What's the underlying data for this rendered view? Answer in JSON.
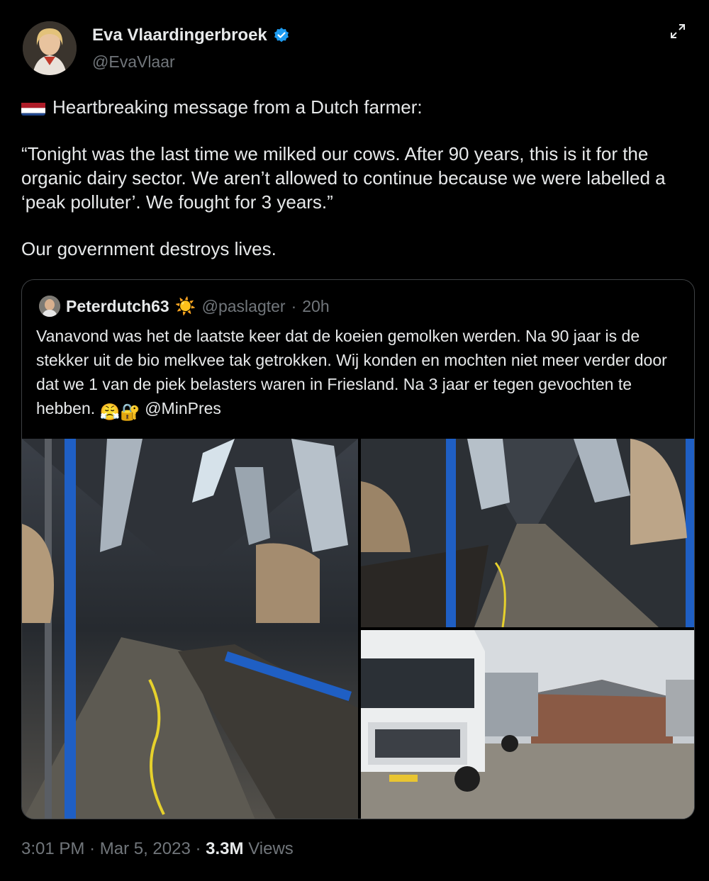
{
  "author": {
    "name": "Eva Vlaardingerbroek",
    "handle": "@EvaVlaar",
    "verified": true
  },
  "tweet": {
    "flag_icon": "netherlands-flag-icon",
    "line1": "Heartbreaking message from a Dutch farmer:",
    "quote_paragraph": "“Tonight was the last time we milked our cows. After 90 years, this is it for the organic dairy sector. We aren’t allowed to continue because we were labelled a ‘peak polluter’. We fought for 3 years.”",
    "closing": "Our government destroys lives."
  },
  "quoted": {
    "name": "Peterdutch63",
    "name_emoji": "☀️",
    "handle": "@paslagter",
    "separator": "·",
    "time": "20h",
    "text": "Vanavond was het de laatste keer dat de koeien gemolken werden. Na 90 jaar is de stekker uit de bio melkvee tak getrokken. Wij konden en mochten niet meer verder door dat we 1 van de piek belasters waren in Friesland. Na 3 jaar er tegen gevochten te hebben.",
    "emojis": "😤🔐",
    "mention": "@MinPres",
    "media": [
      {
        "description": "milking-parlor-wide-photo"
      },
      {
        "description": "milking-parlor-close-photo"
      },
      {
        "description": "milk-tanker-truck-farm-photo"
      }
    ]
  },
  "footer": {
    "time": "3:01 PM",
    "sep1": "·",
    "date": "Mar 5, 2023",
    "sep2": "·",
    "views_count": "3.3M",
    "views_label": "Views"
  },
  "colors": {
    "background": "#000000",
    "text": "#e7e9ea",
    "muted": "#71767b",
    "verified": "#1d9bf0",
    "border": "#3e4144"
  }
}
